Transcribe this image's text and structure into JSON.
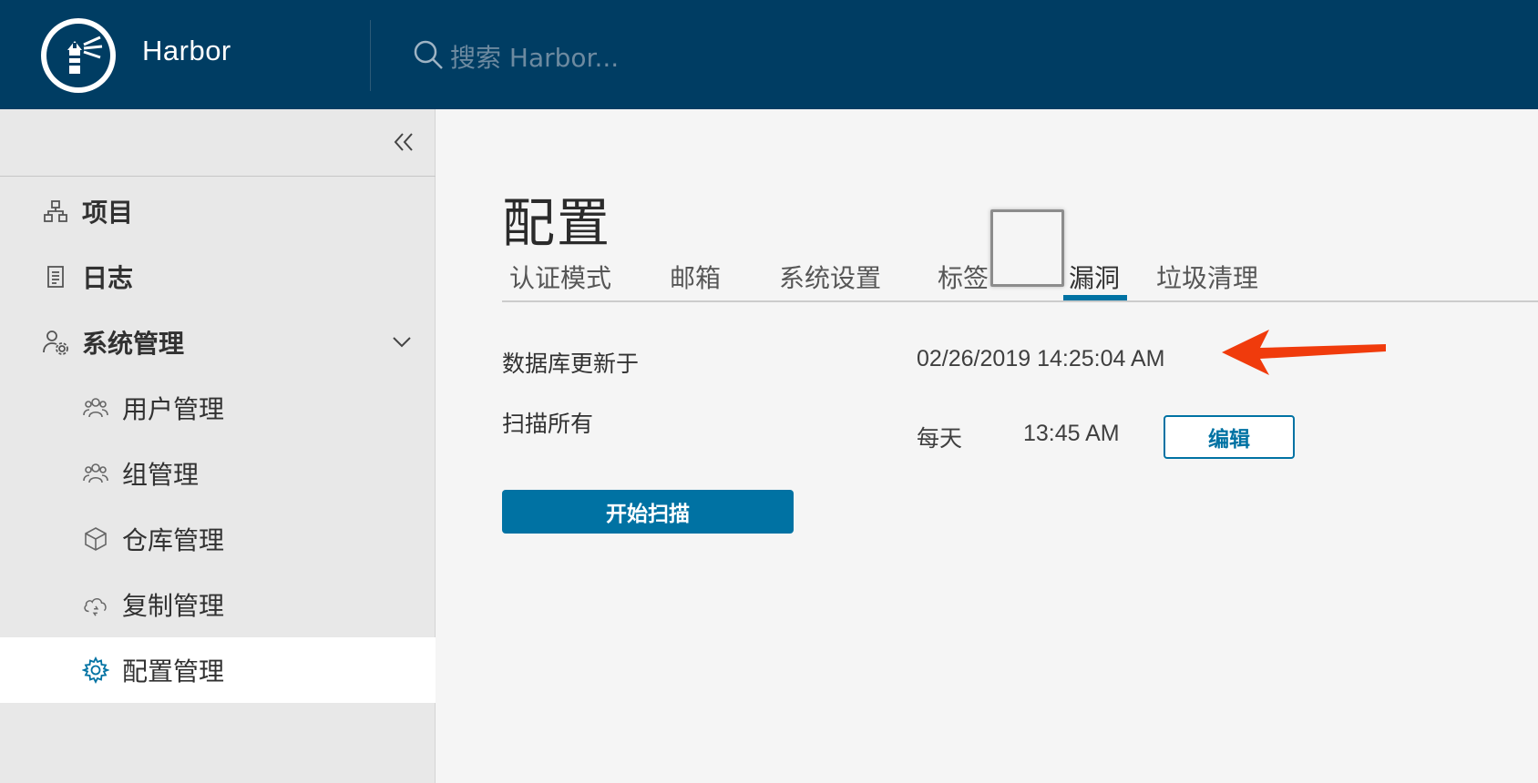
{
  "header": {
    "brand": "Harbor",
    "search_placeholder": "搜索 Harbor..."
  },
  "sidebar": {
    "items": [
      {
        "label": "项目",
        "icon": "projects-icon"
      },
      {
        "label": "日志",
        "icon": "logs-icon"
      },
      {
        "label": "系统管理",
        "icon": "admin-user-gear-icon",
        "expanded": true
      },
      {
        "label": "用户管理",
        "icon": "users-icon"
      },
      {
        "label": "组管理",
        "icon": "groups-icon"
      },
      {
        "label": "仓库管理",
        "icon": "cube-icon"
      },
      {
        "label": "复制管理",
        "icon": "cloud-sync-icon"
      },
      {
        "label": "配置管理",
        "icon": "gear-icon",
        "active": true
      }
    ]
  },
  "main": {
    "title": "配置",
    "tabs": [
      {
        "label": "认证模式"
      },
      {
        "label": "邮箱"
      },
      {
        "label": "系统设置"
      },
      {
        "label": "标签"
      },
      {
        "label": "漏洞",
        "active": true
      },
      {
        "label": "垃圾清理"
      }
    ],
    "db_updated_label": "数据库更新于",
    "db_updated_value": "02/26/2019 14:25:04 AM",
    "scan_all_label": "扫描所有",
    "scan_schedule": "每天",
    "scan_time": "13:45 AM",
    "edit_button": "编辑",
    "start_scan_button": "开始扫描"
  },
  "colors": {
    "header_bg": "#003d63",
    "accent": "#0072a3",
    "annotation_arrow": "#f03b0c"
  }
}
